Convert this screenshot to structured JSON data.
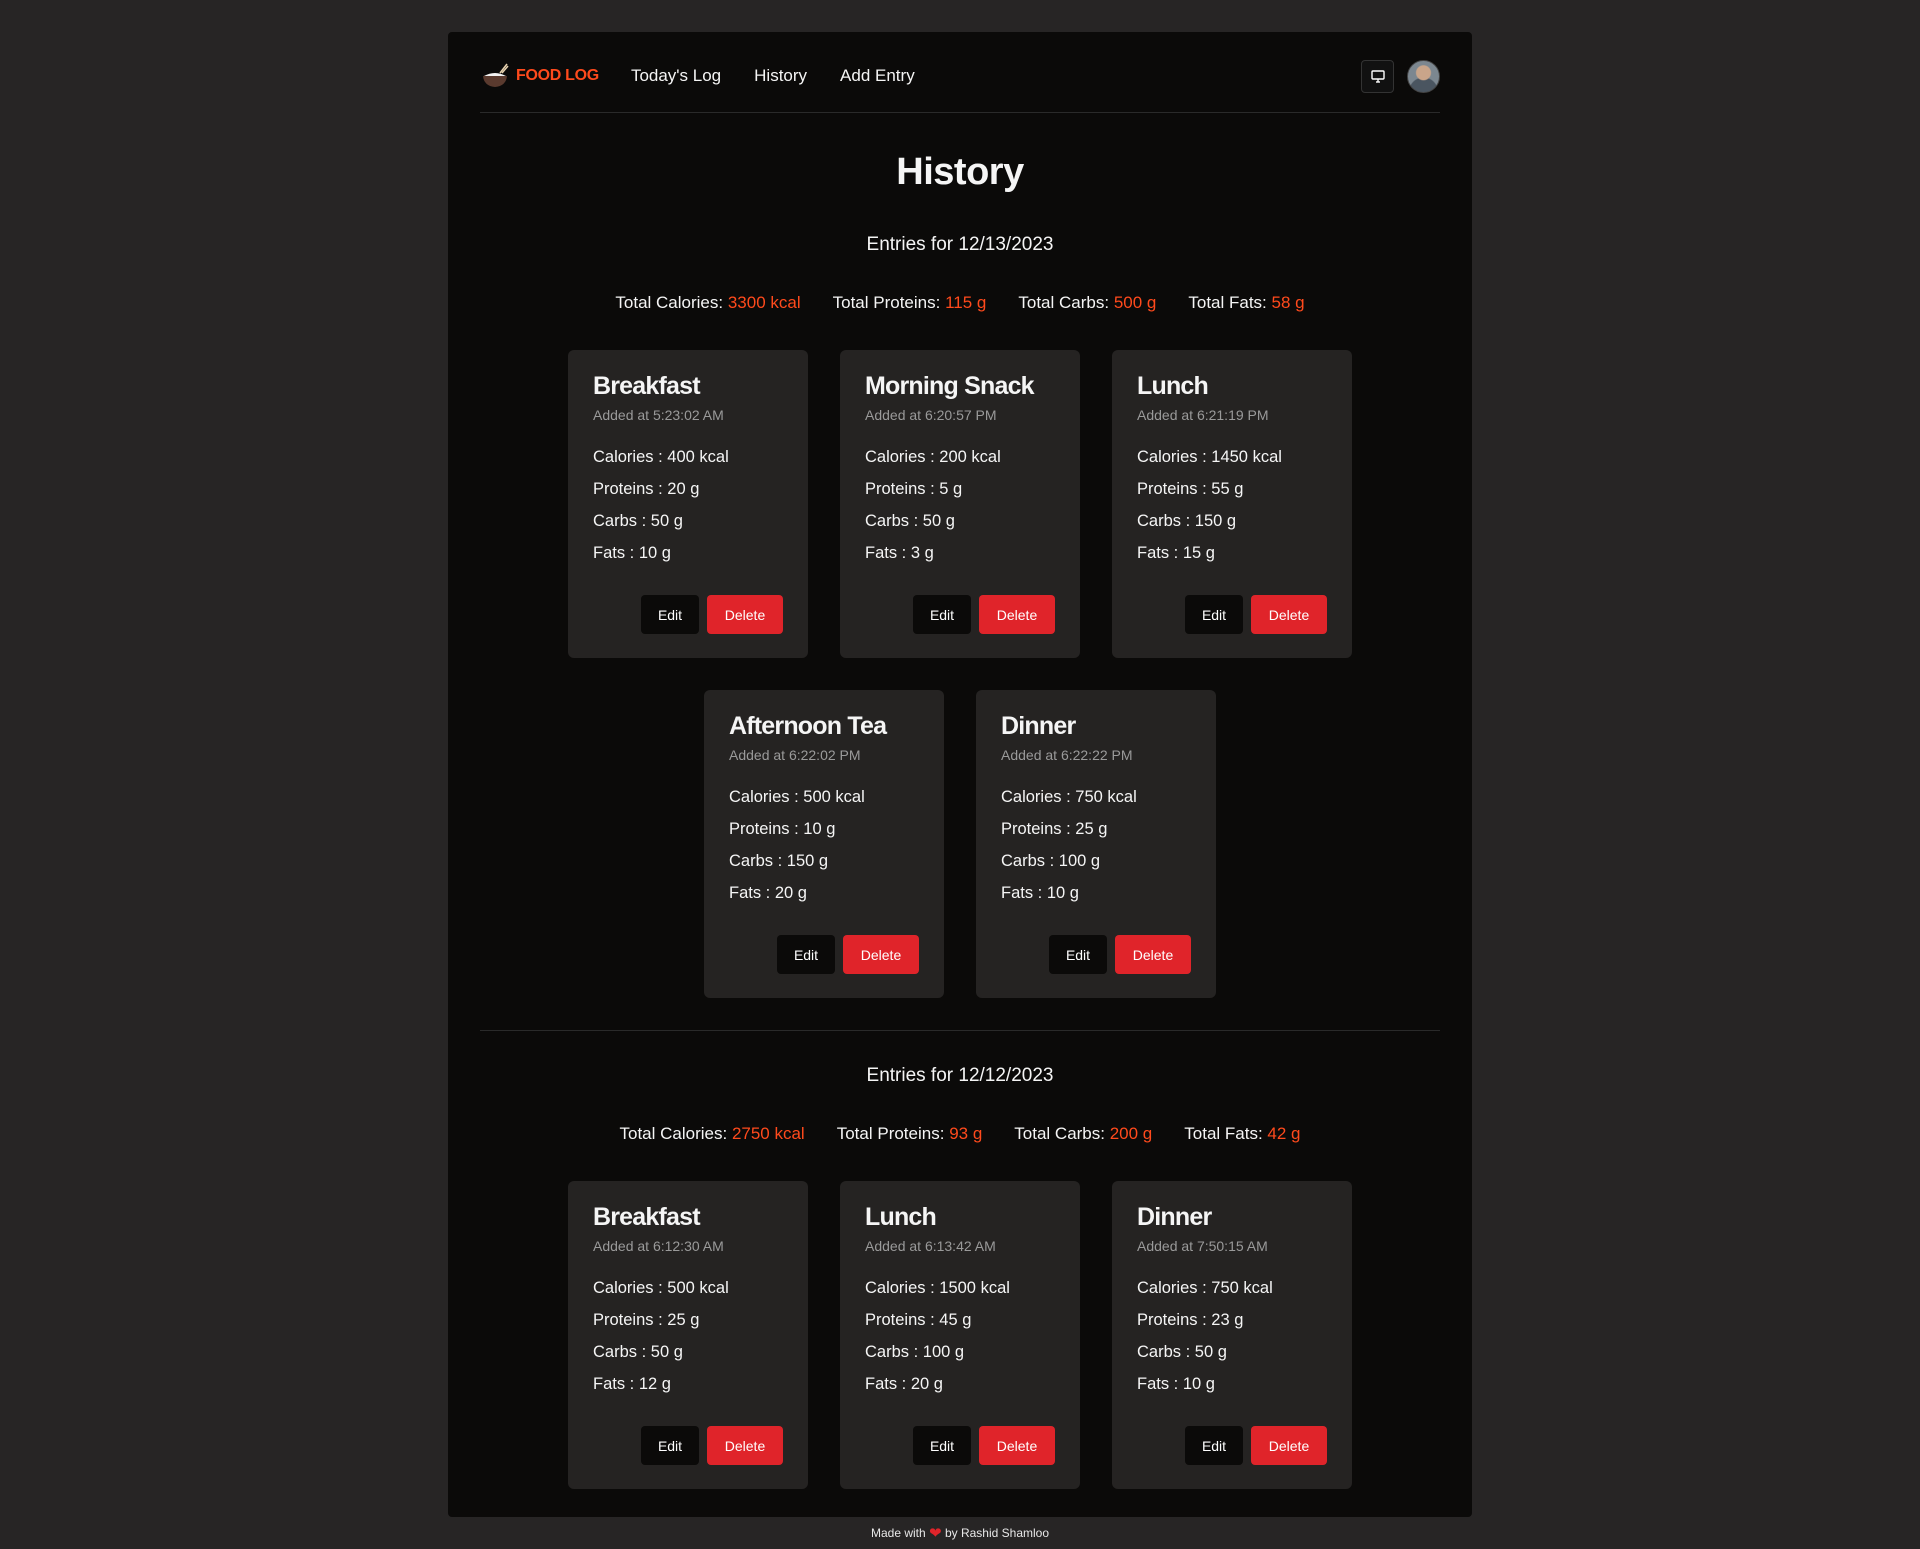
{
  "nav": {
    "brand": "FOOD LOG",
    "links": [
      "Today's Log",
      "History",
      "Add Entry"
    ]
  },
  "page_title": "History",
  "days": [
    {
      "heading": "Entries for 12/13/2023",
      "totals": {
        "calories_label": "Total Calories:",
        "calories": "3300 kcal",
        "proteins_label": "Total Proteins:",
        "proteins": "115 g",
        "carbs_label": "Total Carbs:",
        "carbs": "500 g",
        "fats_label": "Total Fats:",
        "fats": "58 g"
      },
      "entries": [
        {
          "title": "Breakfast",
          "time": "Added at 5:23:02 AM",
          "calories": "Calories : 400 kcal",
          "proteins": "Proteins : 20 g",
          "carbs": "Carbs : 50 g",
          "fats": "Fats : 10 g"
        },
        {
          "title": "Morning Snack",
          "time": "Added at 6:20:57 PM",
          "calories": "Calories : 200 kcal",
          "proteins": "Proteins : 5 g",
          "carbs": "Carbs : 50 g",
          "fats": "Fats : 3 g"
        },
        {
          "title": "Lunch",
          "time": "Added at 6:21:19 PM",
          "calories": "Calories : 1450 kcal",
          "proteins": "Proteins : 55 g",
          "carbs": "Carbs : 150 g",
          "fats": "Fats : 15 g"
        },
        {
          "title": "Afternoon Tea",
          "time": "Added at 6:22:02 PM",
          "calories": "Calories : 500 kcal",
          "proteins": "Proteins : 10 g",
          "carbs": "Carbs : 150 g",
          "fats": "Fats : 20 g"
        },
        {
          "title": "Dinner",
          "time": "Added at 6:22:22 PM",
          "calories": "Calories : 750 kcal",
          "proteins": "Proteins : 25 g",
          "carbs": "Carbs : 100 g",
          "fats": "Fats : 10 g"
        }
      ]
    },
    {
      "heading": "Entries for 12/12/2023",
      "totals": {
        "calories_label": "Total Calories:",
        "calories": "2750 kcal",
        "proteins_label": "Total Proteins:",
        "proteins": "93 g",
        "carbs_label": "Total Carbs:",
        "carbs": "200 g",
        "fats_label": "Total Fats:",
        "fats": "42 g"
      },
      "entries": [
        {
          "title": "Breakfast",
          "time": "Added at 6:12:30 AM",
          "calories": "Calories : 500 kcal",
          "proteins": "Proteins : 25 g",
          "carbs": "Carbs : 50 g",
          "fats": "Fats : 12 g"
        },
        {
          "title": "Lunch",
          "time": "Added at 6:13:42 AM",
          "calories": "Calories : 1500 kcal",
          "proteins": "Proteins : 45 g",
          "carbs": "Carbs : 100 g",
          "fats": "Fats : 20 g"
        },
        {
          "title": "Dinner",
          "time": "Added at 7:50:15 AM",
          "calories": "Calories : 750 kcal",
          "proteins": "Proteins : 23 g",
          "carbs": "Carbs : 50 g",
          "fats": "Fats : 10 g"
        }
      ]
    }
  ],
  "buttons": {
    "edit": "Edit",
    "delete": "Delete"
  },
  "footer": {
    "prefix": "Made with",
    "suffix": "by Rashid Shamloo"
  },
  "colors": {
    "accent": "#ff4a1c",
    "danger": "#e0242a",
    "card": "#252322",
    "panel": "#0b0a09",
    "background": "#272525"
  },
  "icons": {
    "brand": "rice-bowl-icon",
    "display": "monitor-icon",
    "heart": "heart-icon"
  }
}
